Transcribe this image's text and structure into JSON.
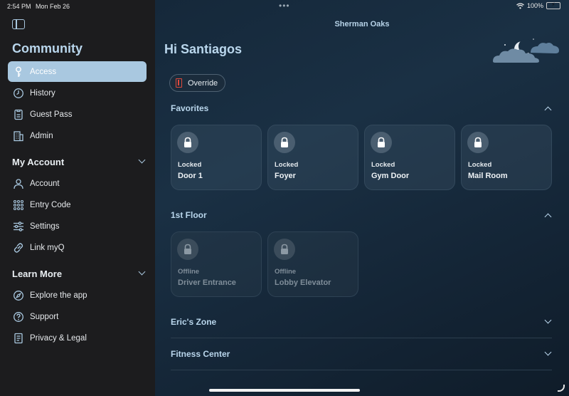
{
  "status_bar": {
    "time": "2:54 PM",
    "date": "Mon Feb 26",
    "battery": "100%",
    "battery_level": 1.0
  },
  "sidebar": {
    "title": "Community",
    "community_items": [
      {
        "label": "Access",
        "icon": "key-icon",
        "active": true
      },
      {
        "label": "History",
        "icon": "clock-icon",
        "active": false
      },
      {
        "label": "Guest Pass",
        "icon": "guest-pass-icon",
        "active": false
      },
      {
        "label": "Admin",
        "icon": "building-icon",
        "active": false
      }
    ],
    "my_account": {
      "title": "My Account",
      "items": [
        {
          "label": "Account",
          "icon": "person-icon"
        },
        {
          "label": "Entry Code",
          "icon": "keypad-icon"
        },
        {
          "label": "Settings",
          "icon": "sliders-icon"
        },
        {
          "label": "Link myQ",
          "icon": "link-icon"
        }
      ]
    },
    "learn_more": {
      "title": "Learn More",
      "items": [
        {
          "label": "Explore the app",
          "icon": "compass-icon"
        },
        {
          "label": "Support",
          "icon": "question-icon"
        },
        {
          "label": "Privacy & Legal",
          "icon": "document-icon"
        }
      ]
    }
  },
  "main": {
    "location": "Sherman Oaks",
    "greeting": "Hi Santiagos",
    "override_label": "Override",
    "groups": [
      {
        "title": "Favorites",
        "expanded": true,
        "doors": [
          {
            "status": "Locked",
            "name": "Door 1"
          },
          {
            "status": "Locked",
            "name": "Foyer"
          },
          {
            "status": "Locked",
            "name": "Gym Door"
          },
          {
            "status": "Locked",
            "name": "Mail Room"
          }
        ]
      },
      {
        "title": "1st Floor",
        "expanded": true,
        "doors": [
          {
            "status": "Offline",
            "name": "Driver Entrance"
          },
          {
            "status": "Offline",
            "name": "Lobby Elevator"
          }
        ]
      },
      {
        "title": "Eric's Zone",
        "expanded": false,
        "doors": []
      },
      {
        "title": "Fitness Center",
        "expanded": false,
        "doors": []
      }
    ]
  },
  "colors": {
    "accent": "#a9c8e0",
    "override_red": "#e04a3c",
    "battery_green": "#3fd14f"
  }
}
